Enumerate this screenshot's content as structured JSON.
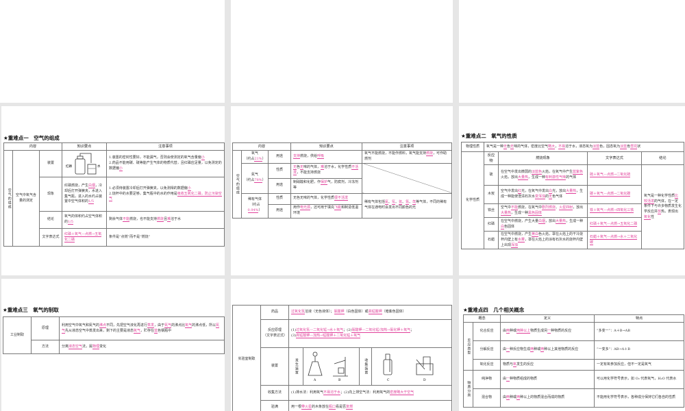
{
  "slide1": {
    "title": "★重难点一　空气的组成",
    "headers": [
      "内容",
      "知识要点",
      "注意事项"
    ],
    "group": "空气的组成",
    "sub": "空气中氧气含量的测定",
    "device_labels": [
      "红磷",
      "水"
    ],
    "rows": [
      {
        "label": "装置",
        "note": "1.装置的密封性要好，不能漏气，否则会使测定的氧气含量偏{小}\n2.药品不能用碳、硫等能产生气体的物质代替，且红磷应足量，以免测定的数据偏{小}"
      },
      {
        "label": "现象",
        "point": "红磷燃烧，产生{白烟}，冷却后打开弹簧夹，水进入集气瓶，进入的水约占装置中空气体积的{1/5}",
        "note": "1.必须待装置冷却后打开弹簧夹，以免测得的数据偏{小}\n2.烧杯中的水要足够，集气瓶中的水的作用是{吸收五氧化二磷，防止污染空气}"
      },
      {
        "label": "结论",
        "point": "氧气的体积约占空气体积的{1/5}",
        "note": "剩余气体{不能}燃烧，也不能支持{燃烧}且{难}溶于水"
      },
      {
        "label": "文字表达式",
        "point": "{红磷＋氧气—点燃→五氧化二磷}",
        "note": "条件是“点燃”而不是“燃烧”"
      }
    ]
  },
  "slide2": {
    "headers": [
      "内容",
      "知识要点",
      "注意事项"
    ],
    "group": "空气的组成",
    "oxygen": {
      "name": "氧气\n（约占{21%}）",
      "use_label": "用途",
      "use": "{支持}燃烧，供给{呼吸}",
      "note": "氧气不能燃烧，不能作燃料，氧气能支持{燃烧}，可作助燃剂"
    },
    "nitrogen": {
      "name": "氮气\n（约占{78%}）",
      "prop_label": "性质",
      "prop": "{无}色{无}味的气体，{难}溶于水，化学性质{不活泼}，不能支持燃烧",
      "use_label": "用途",
      "use": "制硝酸和化肥，作{保护}气，防腐剂，冷冻剂等"
    },
    "noble": {
      "name": "稀有气体\n（约占{0.94%}）",
      "prop_label": "性质",
      "prop": "无色无味的气体，化学性质{很不活泼}",
      "use_label": "用途",
      "use": "用作{电光源}，还可用于填充{飞艇}和制造低温环境",
      "note": "稀有气体包括{氦}、{氖}、{氩}、{氪}、{氙}等气体，不同的稀有气体在通电时会发出不同颜色的光"
    }
  },
  "slide3": {
    "title": "★重难点二　氧气的性质",
    "physical_label": "物理性质",
    "physical": "氧气是一种{无}色{无}味的气体，密度比空气{略大}，{不易}溶于水，液态氧为{淡蓝}色，固态氧为{淡蓝}色{雪花}状",
    "chemical_label": "化学性质",
    "headers": [
      "反应物",
      "燃烧现象",
      "文字表达式",
      "结论"
    ],
    "rows": [
      {
        "name": "硫",
        "phen": "在空气中发出微弱的{淡蓝色}火焰，在氧气中产生{蓝紫色}火焰，放出{大量热}，生成一种{有刺激性气味}的气体",
        "eq": "{硫＋氧气—点燃→二氧化硫}"
      },
      {
        "name": "木炭",
        "phen": "空气中发出{红}光，在氧气中发出{白}光，放出{大量热}，生成一种能使澄清石灰水{变浑浊}的{无}色气体",
        "eq": "{碳＋氧气—点燃→二氧化碳}"
      },
      {
        "name": "铁丝",
        "phen": "空气中{不能}燃烧，在氧气中{剧烈燃烧}、{火星四射}，放出{大量热}，生成一种{黑色固体}",
        "eq": "{铁＋氧气—点燃→四氧化三铁}"
      },
      {
        "name": "红磷",
        "phen": "在空气中燃烧，产生大量{白烟}，放出{大量热}，生成一种{白}色固体",
        "eq": "{红磷＋氧气—点燃→五氧化二磷}"
      },
      {
        "name": "石蜡",
        "phen": "在空气中燃烧，产生{黄白}色火焰，罩在火焰上的干冷烧杯内壁上有{水雾}，罩在火焰上的涂有石灰水的烧杯内壁上出现{浑浊}",
        "eq": "{石蜡＋氧气—点燃→水＋二氧化碳}"
      }
    ],
    "conclusion": "氧气是一种化学性质{比较活泼}的气体，在一定条件下与许多物质发生化学反应并{放}热，表现出{氧化}性"
  },
  "slide4": {
    "title": "★重难点三　氧气的制取",
    "group": "工业制取",
    "principle_label": "原理",
    "principle": "利用空气中氧气和氮气的{沸点}不同，先把空气液化再进行{蒸发}，由于{氮气}的沸点比{氧气}的沸点低，所以{氮气}先从液态空气中蒸发出来，剩下的主要是液态{氧气}，贮存在{蓝}色钢瓶中",
    "method_label": "方法",
    "method": "分离{液态空气}法，属{物理}变化"
  },
  "slide5": {
    "group": "实验室制取",
    "drug_label": "药品",
    "drug": "{过氧化氢}溶液（无色液体）；{氯酸钾}（白色固体）或{高锰酸钾}（暗紫色固体）",
    "principle_label": "反应原理\n（文字表达式）",
    "principle": "(1){过氧化氢—二氧化锰→水＋氧气}；(2){氯酸钾—二氧化锰/加热→氯化钾＋氧气}；\n(3){高锰酸钾—加热→锰酸钾＋二氧化锰＋氧气}",
    "device_label": "装置",
    "gen_label": "发生装置",
    "col_label": "收集装置",
    "apparatus": [
      "A",
      "B",
      "C",
      "D"
    ],
    "collect_label": "收集方法",
    "collect": "(1)排水法：利用氧气{不易溶于水}；(2)向上排空气法：利用氧气的{密度略大于空气}",
    "check_label": "验满",
    "check": "用一根{带火星}的木条放在{瓶口}看是否{复燃}"
  },
  "slide6": {
    "title": "★重难点四　几个相关概念",
    "headers": [
      "概念",
      "定义",
      "特点"
    ],
    "group1": "反应类型",
    "group2": "物质分类",
    "rows": [
      {
        "name": "化合反应",
        "def": "由{两}种或{两种以上}物质生成另{一}种物质的反应",
        "feat": "“多变一”：A＋B→AB"
      },
      {
        "name": "分解反应",
        "def": "由{一}种反应物生成{两}种或{两}种以上其他物质的反应",
        "feat": "“一变多”：AB→A＋B"
      },
      {
        "name": "氧化反应",
        "def": "物质与{氧}发生的反应",
        "feat": "一定有氧参加反应，但不一定是氧气"
      },
      {
        "name": "纯净物",
        "def": "由{一}种物质组成的物质",
        "feat": "可以用化学符号表示，如 O₂ 代表氧气，H₂O 代表水"
      },
      {
        "name": "混合物",
        "def": "由{两}种或{两}种以上的物质混合而成的物质",
        "feat": "不能用化学符号表示，各种成分保持它们各自的性质"
      }
    ]
  },
  "colors": {
    "highlight": "#e0409a",
    "background": "#e6e6e6"
  }
}
